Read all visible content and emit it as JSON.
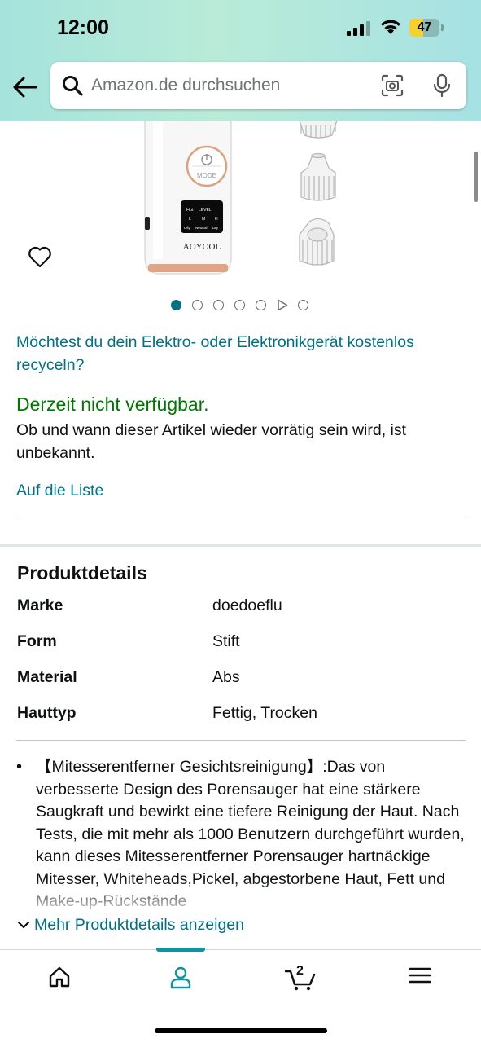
{
  "status_bar": {
    "time": "12:00",
    "battery_level": "47",
    "battery_fraction": 0.47
  },
  "search": {
    "placeholder": "Amazon.de durchsuchen"
  },
  "icons": {
    "back": "arrow-left-icon",
    "search": "search-icon",
    "camera": "camera-scan-icon",
    "mic": "microphone-icon",
    "wishlist": "heart-icon",
    "home": "home-icon",
    "account": "person-icon",
    "cart": "cart-icon",
    "menu": "hamburger-menu-icon"
  },
  "colors": {
    "link": "#007185",
    "available_status": "#007600",
    "accent_teal": "#13919c"
  },
  "product_image": {
    "brand_text": "AOYOOL",
    "button_text": "MODE",
    "display_labels": [
      "Hot",
      "LEVEL",
      "L",
      "M",
      "H",
      "Oily",
      "Neutral",
      "Dry"
    ]
  },
  "gallery": {
    "total": 7,
    "active_index": 0,
    "video_index": 5
  },
  "recycle_link": "Möchtest du dein Elektro- oder Elektronikgerät kostenlos recyceln?",
  "availability": {
    "status": "Derzeit nicht verfügbar.",
    "description": "Ob und wann dieser Artikel wieder vorrätig sein wird, ist unbekannt."
  },
  "wishlist_link": "Auf die Liste",
  "details": {
    "title": "Produktdetails",
    "rows": [
      {
        "key": "Marke",
        "value": "doedoeflu"
      },
      {
        "key": "Form",
        "value": "Stift"
      },
      {
        "key": "Material",
        "value": "Abs"
      },
      {
        "key": "Hauttyp",
        "value": "Fettig, Trocken"
      }
    ],
    "bullet": "【Mitesserentferner Gesichtsreinigung】:Das von verbesserte Design des Porensauger hat eine stärkere Saugkraft und bewirkt eine tiefere Reinigung der Haut. Nach Tests, die mit mehr als 1000 Benutzern durchgeführt wurden, kann dieses Mitesserentferner Porensauger hartnäckige Mitesser, Whiteheads,Pickel, abgestorbene Haut, Fett und Make-up-Rückstände",
    "more_link": "Mehr Produktdetails anzeigen"
  },
  "bottom_nav": {
    "active": "account",
    "cart_count": "2"
  }
}
